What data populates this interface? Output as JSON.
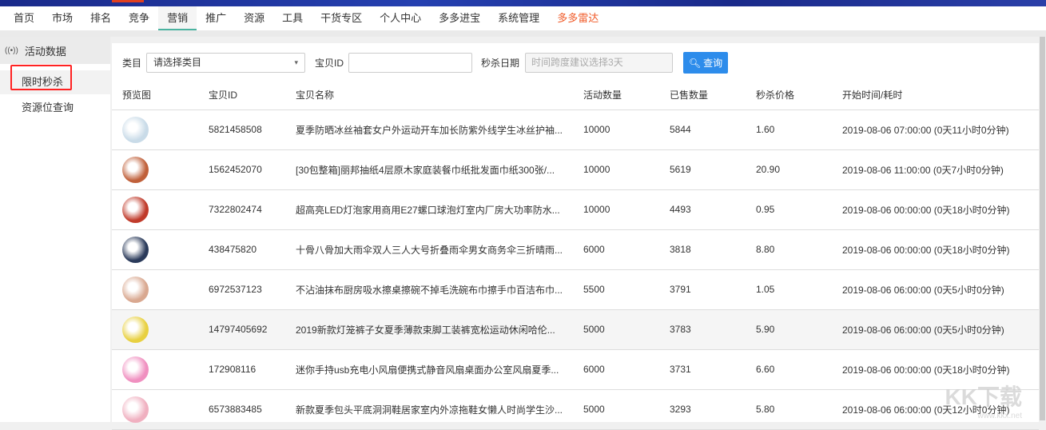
{
  "nav": {
    "items": [
      "首页",
      "市场",
      "排名",
      "竞争",
      "营销",
      "推广",
      "资源",
      "工具",
      "干货专区",
      "个人中心",
      "多多进宝",
      "系统管理",
      "多多雷达"
    ],
    "active": 4,
    "hot": 12,
    "hot_color": "#f05a28"
  },
  "sidebar": {
    "group": "活动数据",
    "items": [
      "限时秒杀",
      "资源位查询"
    ]
  },
  "filters": {
    "category_label": "类目",
    "category_value": "请选择类目",
    "id_label": "宝贝ID",
    "id_value": "",
    "date_label": "秒杀日期",
    "date_placeholder": "时间跨度建议选择3天",
    "search_label": "查询"
  },
  "table": {
    "headers": [
      "预览图",
      "宝贝ID",
      "宝贝名称",
      "活动数量",
      "已售数量",
      "秒杀价格",
      "开始时间/耗时"
    ],
    "rows": [
      [
        "5821458508",
        "夏季防晒冰丝袖套女户外运动开车加长防紫外线学生冰丝护袖...",
        "10000",
        "5844",
        "1.60",
        "2019-08-06 07:00:00  (0天11小时0分钟)"
      ],
      [
        "1562452070",
        "[30包整箱]丽邦抽纸4层原木家庭装餐巾纸批发面巾纸300张/...",
        "10000",
        "5619",
        "20.90",
        "2019-08-06 11:00:00  (0天7小时0分钟)"
      ],
      [
        "7322802474",
        "超高亮LED灯泡家用商用E27螺口球泡灯室内厂房大功率防水...",
        "10000",
        "4493",
        "0.95",
        "2019-08-06 00:00:00  (0天18小时0分钟)"
      ],
      [
        "438475820",
        "十骨八骨加大雨伞双人三人大号折叠雨伞男女商务伞三折晴雨...",
        "6000",
        "3818",
        "8.80",
        "2019-08-06 00:00:00  (0天18小时0分钟)"
      ],
      [
        "6972537123",
        "不沾油抹布厨房吸水擦桌擦碗不掉毛洗碗布巾擦手巾百洁布巾...",
        "5500",
        "3791",
        "1.05",
        "2019-08-06 06:00:00  (0天5小时0分钟)"
      ],
      [
        "14797405692",
        "2019新款灯笼裤子女夏季薄款束脚工装裤宽松运动休闲哈伦...",
        "5000",
        "3783",
        "5.90",
        "2019-08-06 06:00:00  (0天5小时0分钟)"
      ],
      [
        "172908116",
        "迷你手持usb充电小风扇便携式静音风扇桌面办公室风扇夏季...",
        "6000",
        "3731",
        "6.60",
        "2019-08-06 00:00:00  (0天18小时0分钟)"
      ],
      [
        "6573883485",
        "新款夏季包头平底洞洞鞋居家室内外凉拖鞋女懒人时尚学生沙...",
        "5000",
        "3293",
        "5.80",
        "2019-08-06 06:00:00  (0天12小时0分钟)"
      ]
    ],
    "thumb_colors": [
      "#c9dbe8",
      "#c0603a",
      "#c03a2a",
      "#2a3a5a",
      "#d9a890",
      "#e8d040",
      "#f090c0",
      "#f0b0c0"
    ]
  },
  "watermark": {
    "text": "KK下载",
    "url": "www.kkx.net"
  }
}
